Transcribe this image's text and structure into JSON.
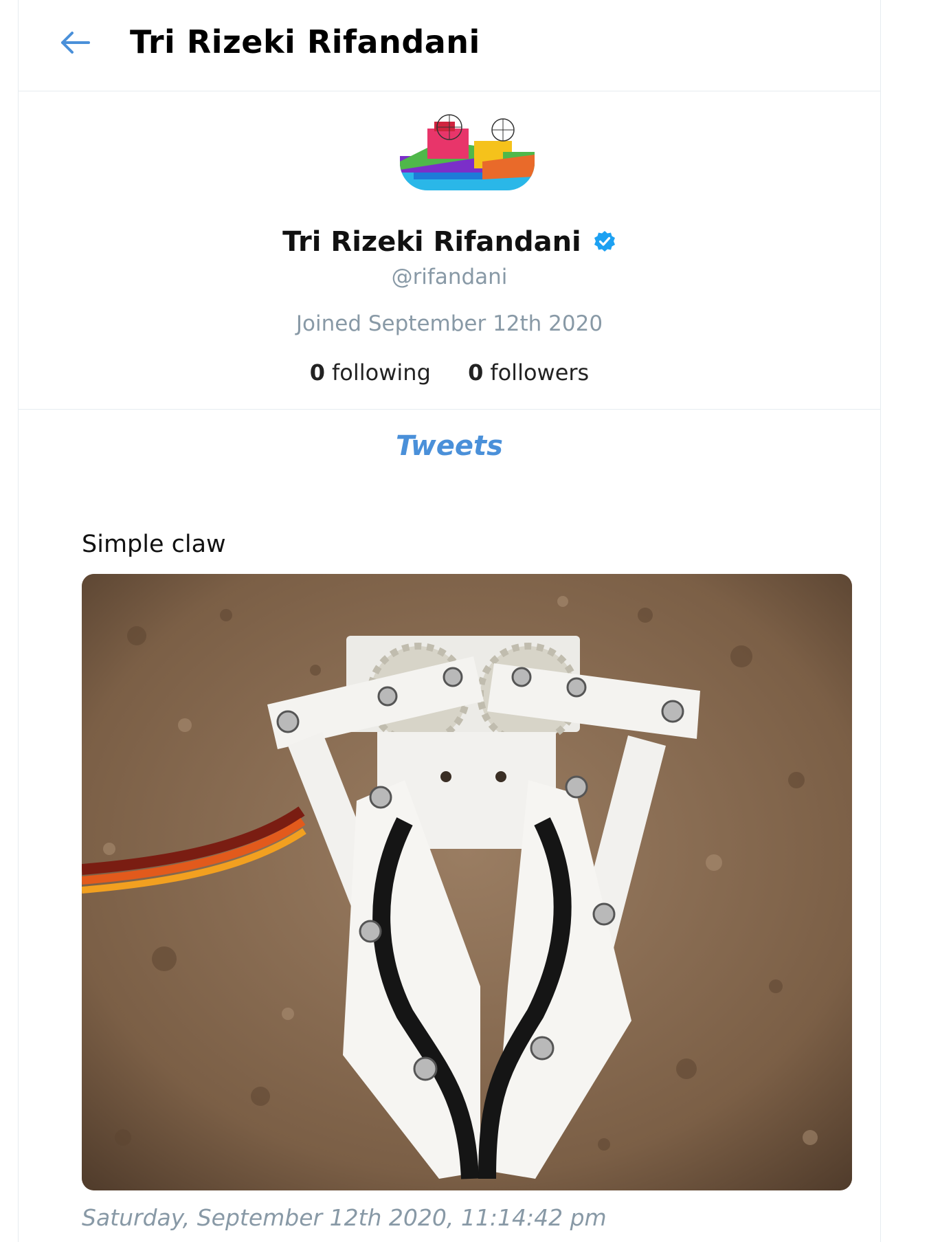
{
  "header": {
    "back_icon": "arrow-left-icon",
    "title": "Tri Rizeki Rifandani"
  },
  "profile": {
    "avatar_icon": "colorful-windmill-drawing",
    "name": "Tri Rizeki Rifandani",
    "verified_icon": "verified-badge-icon",
    "handle": "@rifandani",
    "joined": "Joined September 12th 2020",
    "following_count": "0",
    "following_label": "following",
    "followers_count": "0",
    "followers_label": "followers"
  },
  "tabs": {
    "tweets_label": "Tweets"
  },
  "tweets": [
    {
      "text": "Simple claw",
      "image_icon": "robot-claw-photo",
      "date": "Saturday, September 12th 2020, 11:14:42 pm"
    }
  ],
  "colors": {
    "accent": "#4a90d9",
    "muted": "#8899a6",
    "verified": "#1da1f2",
    "divider": "#e6ecf0"
  }
}
